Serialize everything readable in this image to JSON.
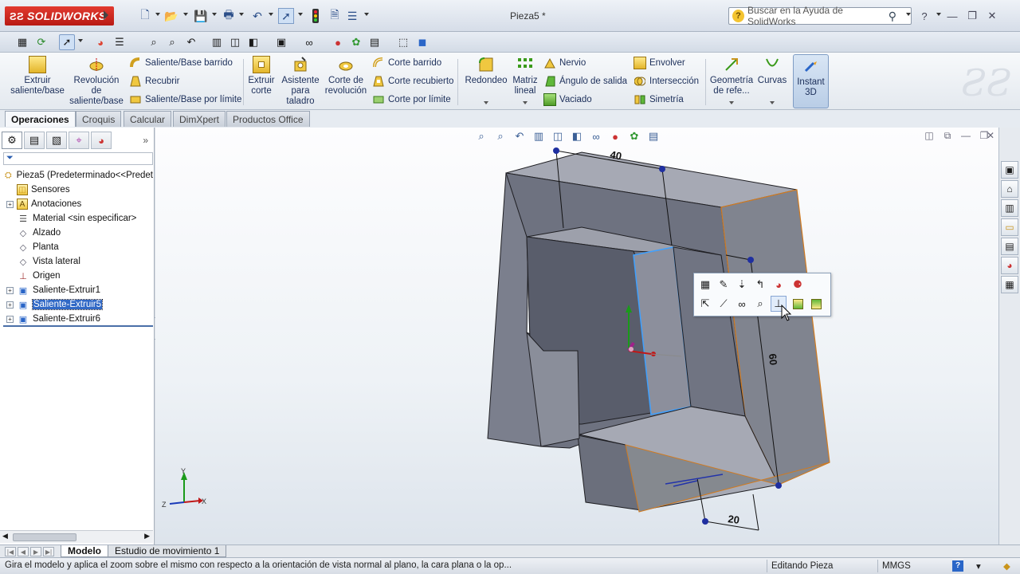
{
  "app": {
    "logo_text": "SOLIDWORKS",
    "document_title": "Pieza5 *"
  },
  "help": {
    "search_placeholder": "Buscar en la Ayuda de SolidWorks",
    "help_symbol": "?"
  },
  "ribbon": {
    "extrude_boss": "Extruir saliente/base",
    "revolve_boss": "Revolución de saliente/base",
    "sweep_boss": "Saliente/Base barrido",
    "loft_boss": "Recubrir",
    "boundary_boss": "Saliente/Base por límite",
    "extrude_cut": "Extruir corte",
    "hole_wizard": "Asistente para taladro",
    "revolve_cut": "Corte de revolución",
    "sweep_cut": "Corte barrido",
    "loft_cut": "Corte recubierto",
    "boundary_cut": "Corte por límite",
    "fillet": "Redondeo",
    "linear_pattern": "Matriz lineal",
    "rib": "Nervio",
    "draft": "Ángulo de salida",
    "shell": "Vaciado",
    "wrap": "Envolver",
    "intersect": "Intersección",
    "mirror": "Simetría",
    "ref_geometry": "Geometría de refe...",
    "curves": "Curvas",
    "instant3d": "Instant 3D"
  },
  "tabs": [
    {
      "label": "Operaciones",
      "active": true
    },
    {
      "label": "Croquis",
      "active": false
    },
    {
      "label": "Calcular",
      "active": false
    },
    {
      "label": "DimXpert",
      "active": false
    },
    {
      "label": "Productos Office",
      "active": false
    }
  ],
  "feature_tree": {
    "root": "Pieza5  (Predeterminado<<Predet",
    "items": [
      {
        "label": "Sensores",
        "icon": "sensors-icon",
        "expandable": false,
        "selected": false
      },
      {
        "label": "Anotaciones",
        "icon": "annotations-icon",
        "expandable": true,
        "selected": false
      },
      {
        "label": "Material <sin especificar>",
        "icon": "material-icon",
        "expandable": false,
        "selected": false
      },
      {
        "label": "Alzado",
        "icon": "plane-icon",
        "expandable": false,
        "selected": false
      },
      {
        "label": "Planta",
        "icon": "plane-icon",
        "expandable": false,
        "selected": false
      },
      {
        "label": "Vista lateral",
        "icon": "plane-icon",
        "expandable": false,
        "selected": false
      },
      {
        "label": "Origen",
        "icon": "origin-icon",
        "expandable": false,
        "selected": false
      },
      {
        "label": "Saliente-Extruir1",
        "icon": "extrude-feature-icon",
        "expandable": true,
        "selected": false
      },
      {
        "label": "Saliente-Extruir5",
        "icon": "extrude-feature-icon",
        "expandable": true,
        "selected": true
      },
      {
        "label": "Saliente-Extruir6",
        "icon": "extrude-feature-icon",
        "expandable": true,
        "selected": false
      }
    ]
  },
  "viewport": {
    "dimensions": [
      "40",
      "60",
      "20"
    ],
    "triad": {
      "x": "X",
      "y": "Y",
      "z": "Z"
    }
  },
  "model_tabs": [
    {
      "label": "Modelo",
      "active": true
    },
    {
      "label": "Estudio de movimiento 1",
      "active": false
    }
  ],
  "status": {
    "message": "Gira el modelo y aplica el zoom sobre el mismo con respecto a la orientación de vista normal al plano, la cara plana o la op...",
    "mode": "Editando Pieza",
    "units": "MMGS",
    "help_symbol": "?"
  },
  "colors": {
    "model_face": "#7a7e8c",
    "model_edge": "#1e1e22",
    "selected_edge": "#d07a20",
    "selected_face_edge": "#3ea0ff",
    "accent": "#3169c6",
    "logo_red": "#d42a22"
  }
}
